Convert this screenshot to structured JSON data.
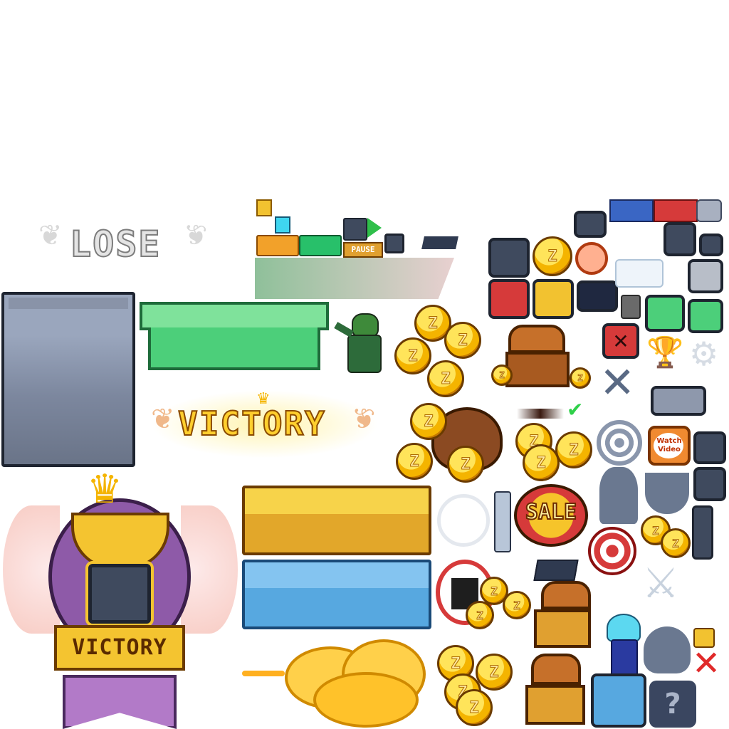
{
  "banners": {
    "lose": "LOSE",
    "victory_top": "VICTORY",
    "victory_badge": "VICTORY"
  },
  "buttons": {
    "pause": "PAUSE",
    "watch_video_line1": "Watch",
    "watch_video_line2": "Video",
    "sale": "SALE"
  },
  "coin_letter": "Z",
  "icons": [
    "lock-icon",
    "alarm-clock-icon",
    "trophy-icon",
    "gear-icon",
    "target-icon",
    "crossed-swords-icon",
    "skull-icon",
    "close-x-icon",
    "checkmark-icon",
    "play-icon",
    "dartboard-icon",
    "treasure-chest-icon",
    "coin-bag-icon",
    "cloud-icon",
    "question-icon"
  ],
  "colors": {
    "gold": "#f4b400",
    "green": "#4ccf7a",
    "blue": "#57a8e0",
    "red": "#d63a3a",
    "slate": "#3f4a5e",
    "purple": "#8e5aa8"
  }
}
